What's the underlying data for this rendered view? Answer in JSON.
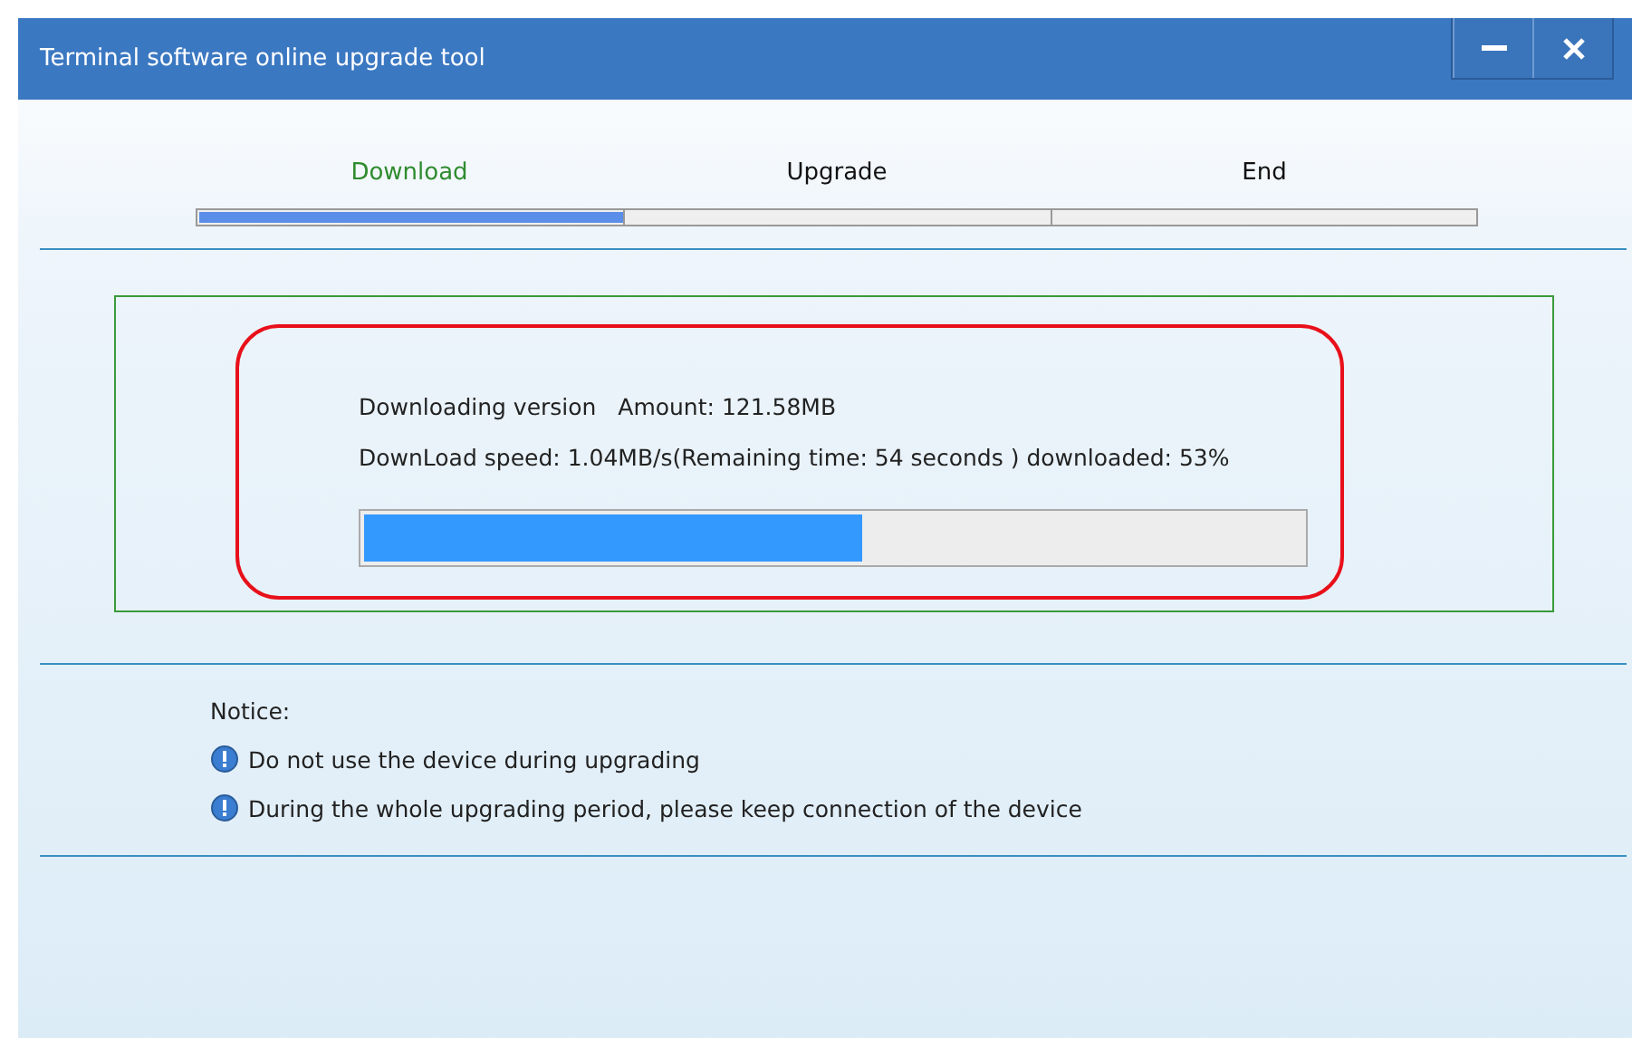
{
  "window": {
    "title": "Terminal software online upgrade tool"
  },
  "steps": [
    {
      "label": "Download",
      "selected": true
    },
    {
      "label": "Upgrade",
      "selected": false
    },
    {
      "label": "End",
      "selected": false
    }
  ],
  "step_progress": {
    "level": 0.333
  },
  "download": {
    "version_line": "Downloading version   Amount: 121.58MB",
    "speed_line": "DownLoad speed: 1.04MB/s(Remaining time: 54 seconds ) downloaded: 53%",
    "level": 0.53
  },
  "notice": {
    "title": "Notice:",
    "items": [
      "Do not use the device during upgrading",
      "During the whole upgrading period, please keep connection of the device"
    ]
  }
}
